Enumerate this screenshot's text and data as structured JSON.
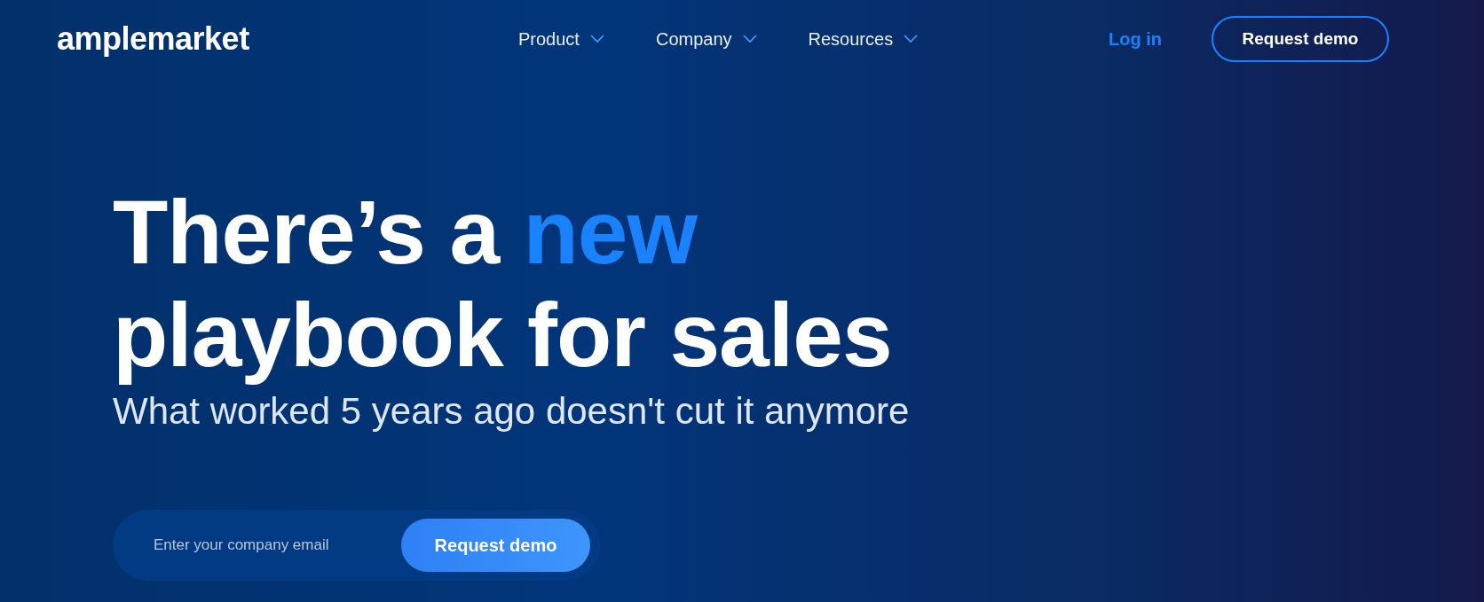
{
  "header": {
    "logo": "amplemarket",
    "nav": [
      {
        "label": "Product"
      },
      {
        "label": "Company"
      },
      {
        "label": "Resources"
      }
    ],
    "login": "Log in",
    "cta": "Request demo"
  },
  "hero": {
    "headline_start": "There’s a",
    "headline_highlight": "new",
    "headline_end": "playbook for sales",
    "subtitle": "What worked 5 years ago doesn't cut it anymore"
  },
  "form": {
    "placeholder": "Enter your company email",
    "button": "Request demo"
  }
}
